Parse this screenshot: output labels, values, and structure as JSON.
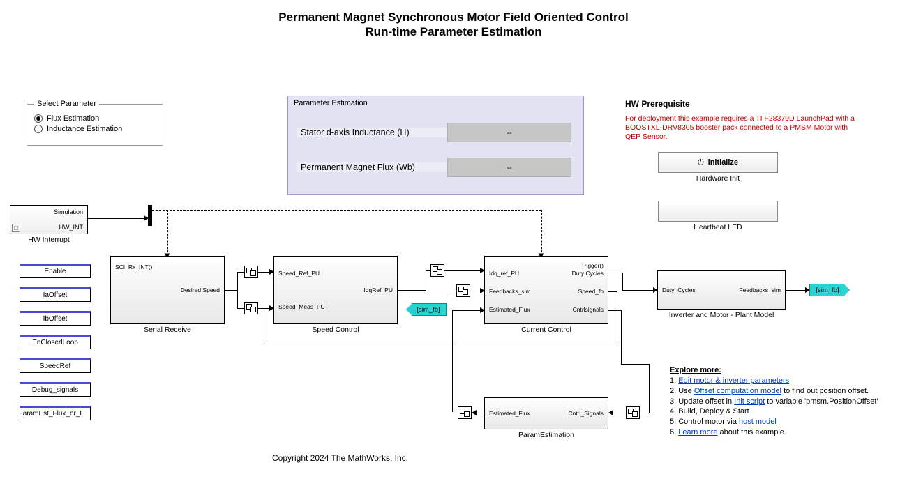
{
  "title": {
    "line1": "Permanent Magnet Synchronous Motor Field Oriented Control",
    "line2": "Run-time Parameter Estimation"
  },
  "selectParameter": {
    "legend": "Select Parameter",
    "opt1": "Flux Estimation",
    "opt2": "Inductance Estimation",
    "selected": "Flux Estimation"
  },
  "paramEstimation": {
    "title": "Parameter Estimation",
    "row1_label": "Stator d-axis Inductance  (H)",
    "row1_value": "--",
    "row2_label": "Permanent Magnet Flux (Wb)",
    "row2_value": "--"
  },
  "hw": {
    "heading": "HW Prerequisite",
    "body": "For deployment this example requires a TI F28379D LaunchPad with a BOOSTXL-DRV8305 booster pack connected to a PMSM Motor with QEP Sensor.",
    "initialize": "initialize",
    "hw_init_label": "Hardware Init",
    "heartbeat_label": "Heartbeat LED"
  },
  "hwint": {
    "r1": "Simulation",
    "r2": "HW_INT",
    "label": "HW Interrupt"
  },
  "dstores": [
    "Enable",
    "IaOffset",
    "IbOffset",
    "EnClosedLoop",
    "SpeedRef",
    "Debug_signals",
    "ParamEst_Flux_or_L"
  ],
  "blocks": {
    "serial": {
      "label": "Serial Receive",
      "p_top": "SCI_Rx_INT()",
      "p_out": "Desired Speed"
    },
    "speed": {
      "label": "Speed Control",
      "p_in1": "Speed_Ref_PU",
      "p_in2": "Speed_Meas_PU",
      "p_out": "IdqRef_PU"
    },
    "current": {
      "label": "Current Control",
      "p_in1": "Idq_ref_PU",
      "p_in2": "Feedbacks_sim",
      "p_in3": "Estimated_Flux",
      "p_top": "Trigger()",
      "p_out1": "Duty Cycles",
      "p_out2": "Speed_fb",
      "p_out3": "Cntrlsignals"
    },
    "inverter": {
      "label": "Inverter and Motor - Plant Model",
      "p_in": "Duty_Cycles",
      "p_out": "Feedbacks_sim"
    },
    "paramest": {
      "label": "ParamEstimation",
      "p_in": "Cntrl_Signals",
      "p_out": "Estimated_Flux"
    }
  },
  "tags": {
    "sim_fb_from": "[sim_fb]",
    "sim_fb_goto": "[sim_fb]"
  },
  "explore": {
    "hdr": "Explore more:",
    "l1a": "1. ",
    "l1b": "Edit motor & inverter parameters",
    "l2a": "2. Use ",
    "l2b": "Offset computation model",
    "l2c": " to find out position offset.",
    "l3a": "3. Update offset in ",
    "l3b": "Init script",
    "l3c": " to variable 'pmsm.PositionOffset'",
    "l4": "4. Build, Deploy & Start",
    "l5a": "5. Control motor via ",
    "l5b": "host model",
    "l6a": "6. ",
    "l6b": "Learn more",
    "l6c": " about this example."
  },
  "copyright": "Copyright 2024 The MathWorks, Inc."
}
